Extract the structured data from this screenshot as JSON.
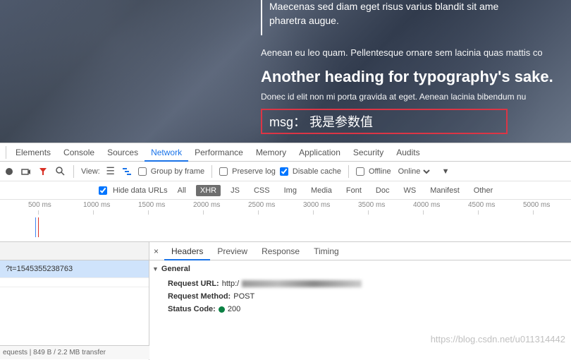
{
  "hero": {
    "quote1": "Maecenas sed diam eget risus varius blandit sit ame",
    "quote2": "pharetra augue.",
    "lead": "Aenean eu leo quam. Pellentesque ornare sem lacinia quas mattis co",
    "heading": "Another heading for typography's sake.",
    "para": "Donec id elit non mi porta gravida at eget. Aenean lacinia bibendum nu",
    "msg": "msg： 我是参数值"
  },
  "devtools": {
    "tabs": [
      "Elements",
      "Console",
      "Sources",
      "Network",
      "Performance",
      "Memory",
      "Application",
      "Security",
      "Audits"
    ],
    "active_tab": "Network",
    "toolbar": {
      "view_label": "View:",
      "group_by_frame": "Group by frame",
      "preserve_log": "Preserve log",
      "disable_cache": "Disable cache",
      "offline": "Offline",
      "online": "Online"
    },
    "filter": {
      "hide_data_urls": "Hide data URLs",
      "types": [
        "All",
        "XHR",
        "JS",
        "CSS",
        "Img",
        "Media",
        "Font",
        "Doc",
        "WS",
        "Manifest",
        "Other"
      ],
      "active_type": "XHR"
    },
    "timeline": {
      "ticks": [
        "500 ms",
        "1000 ms",
        "1500 ms",
        "2000 ms",
        "2500 ms",
        "3000 ms",
        "3500 ms",
        "4000 ms",
        "4500 ms",
        "5000 ms"
      ]
    },
    "requests": {
      "items": [
        "?t=1545355238763"
      ],
      "footer": "equests | 849 B / 2.2 MB transfer"
    },
    "details": {
      "tabs": [
        "Headers",
        "Preview",
        "Response",
        "Timing"
      ],
      "active": "Headers",
      "general": {
        "section": "General",
        "url_k": "Request URL:",
        "url_v": "http:/",
        "method_k": "Request Method:",
        "method_v": "POST",
        "status_k": "Status Code:",
        "status_v": "200"
      }
    },
    "watermark": "https://blog.csdn.net/u011314442"
  }
}
